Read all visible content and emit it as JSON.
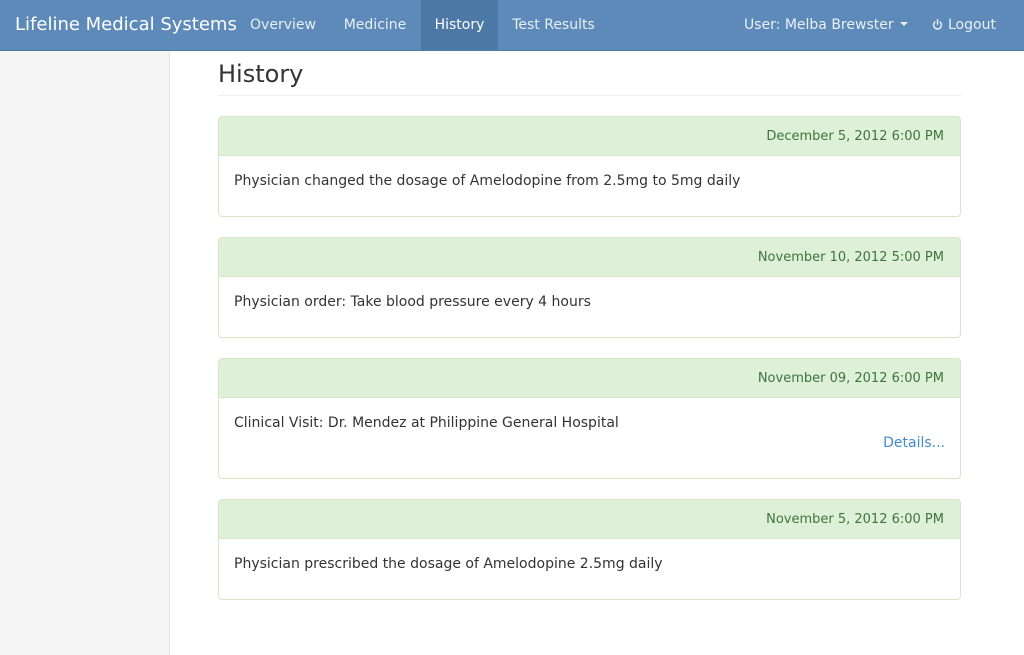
{
  "app": {
    "brand": "Lifeline Medical Systems"
  },
  "nav": {
    "items": [
      {
        "label": "Overview"
      },
      {
        "label": "Medicine"
      },
      {
        "label": "History"
      },
      {
        "label": "Test Results"
      }
    ],
    "active": "History",
    "user_label": "User: Melba Brewster",
    "logout_label": "Logout"
  },
  "page": {
    "title": "History"
  },
  "history": [
    {
      "date": "December 5, 2012 6:00 PM",
      "text": "Physician changed the dosage of Amelodopine from 2.5mg to 5mg daily"
    },
    {
      "date": "November 10, 2012 5:00 PM",
      "text": "Physician order: Take blood pressure every 4 hours"
    },
    {
      "date": "November 09, 2012 6:00 PM",
      "text": "Clinical Visit: Dr. Mendez at Philippine General Hospital",
      "link": "Details..."
    },
    {
      "date": "November 5, 2012 6:00 PM",
      "text": "Physician prescribed the dosage of Amelodopine 2.5mg daily"
    }
  ],
  "colors": {
    "navbar": "#5d8ab8",
    "card_header": "#dff0d8",
    "card_date": "#3c763d",
    "link": "#428bca"
  },
  "icons": {
    "logout": "power-icon",
    "user_menu": "caret-down-icon"
  }
}
